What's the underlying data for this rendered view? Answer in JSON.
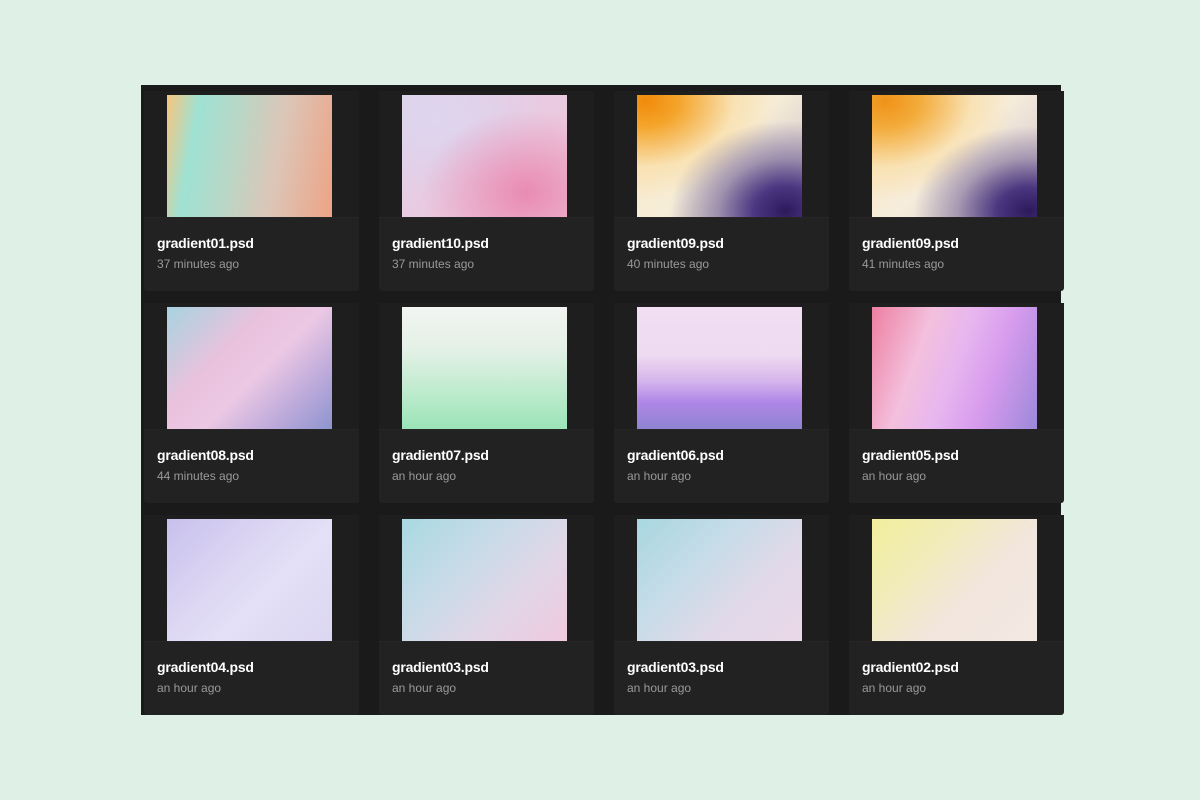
{
  "files": [
    {
      "name": "gradient01.psd",
      "time": "37 minutes ago",
      "thumb": "g-1"
    },
    {
      "name": "gradient10.psd",
      "time": "37 minutes ago",
      "thumb": "g-2"
    },
    {
      "name": "gradient09.psd",
      "time": "40 minutes ago",
      "thumb": "g-3"
    },
    {
      "name": "gradient09.psd",
      "time": "41 minutes ago",
      "thumb": "g-4"
    },
    {
      "name": "gradient08.psd",
      "time": "44 minutes ago",
      "thumb": "g-5"
    },
    {
      "name": "gradient07.psd",
      "time": "an hour ago",
      "thumb": "g-6"
    },
    {
      "name": "gradient06.psd",
      "time": "an hour ago",
      "thumb": "g-7"
    },
    {
      "name": "gradient05.psd",
      "time": "an hour ago",
      "thumb": "g-8"
    },
    {
      "name": "gradient04.psd",
      "time": "an hour ago",
      "thumb": "g-9"
    },
    {
      "name": "gradient03.psd",
      "time": "an hour ago",
      "thumb": "g-10"
    },
    {
      "name": "gradient03.psd",
      "time": "an hour ago",
      "thumb": "g-11"
    },
    {
      "name": "gradient02.psd",
      "time": "an hour ago",
      "thumb": "g-12"
    }
  ],
  "colors": {
    "page_background": "#dff1e6",
    "panel_background": "#1a1a1a",
    "card_background": "#222222",
    "file_name": "#ffffff",
    "timestamp": "#9a9a9a"
  }
}
